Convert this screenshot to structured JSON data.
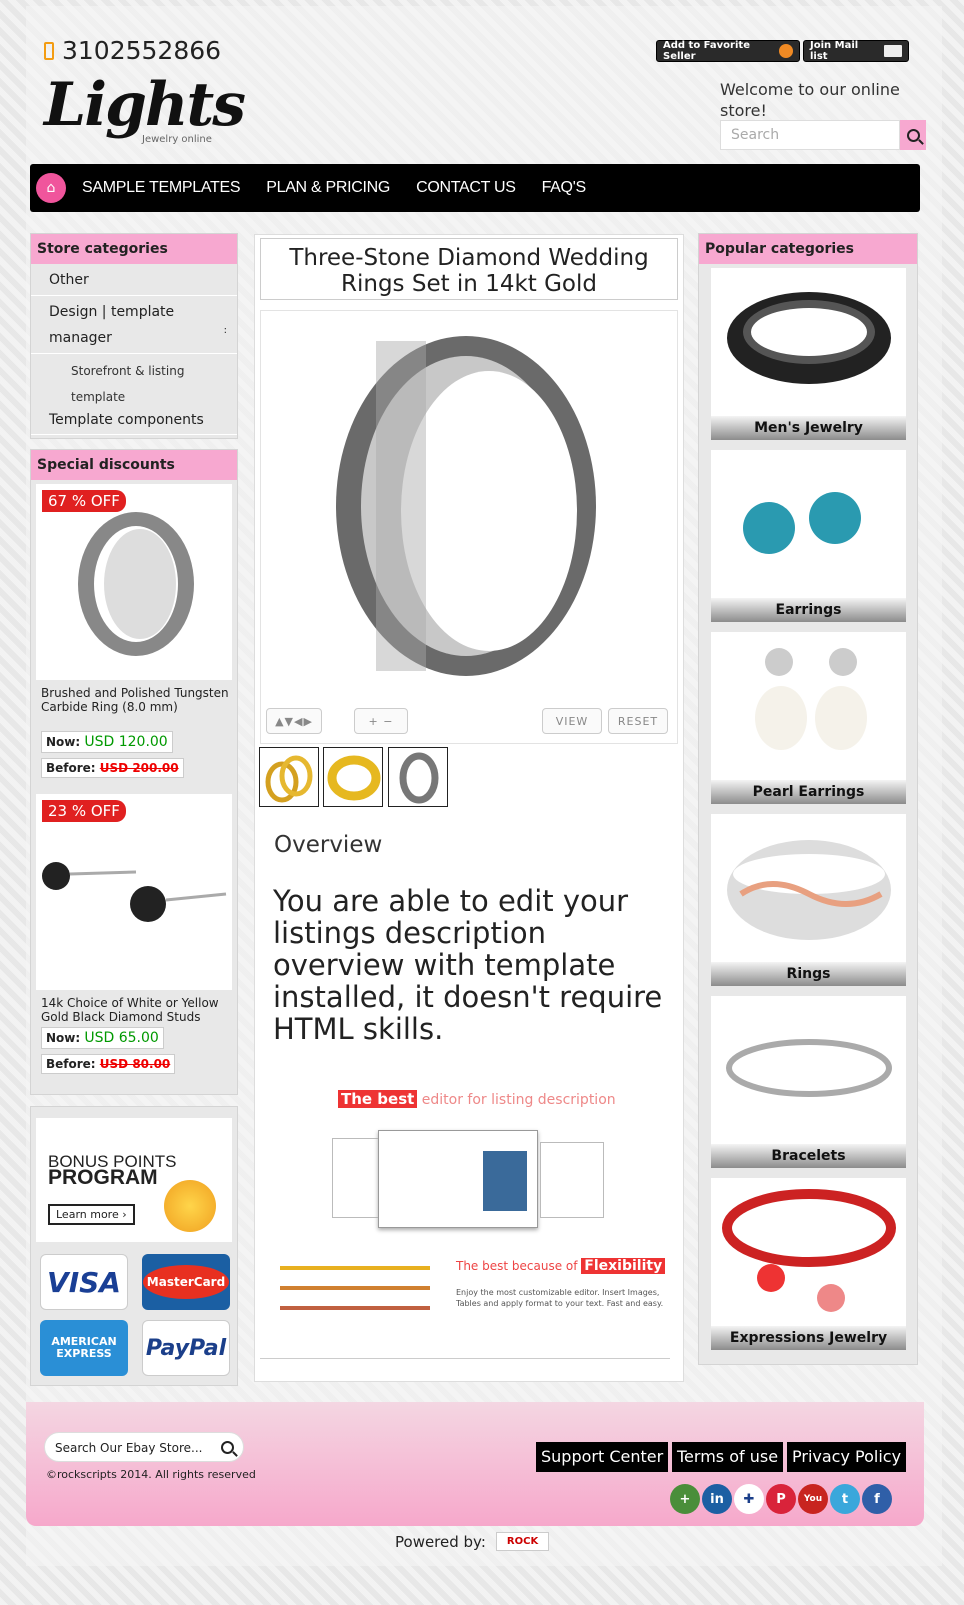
{
  "header": {
    "phone": "3102552866",
    "logo": "Lights",
    "logo_sub": "Jewelry online",
    "fav_seller": "Add to Favorite Seller",
    "mail_list": "Join Mail list",
    "welcome": "Welcome to our online store!",
    "search_placeholder": "Search"
  },
  "nav": [
    "SAMPLE TEMPLATES",
    "PLAN & PRICING",
    "CONTACT US",
    "FAQ'S"
  ],
  "store_categories": {
    "title": "Store categories",
    "other": "Other",
    "design": "Design | template manager",
    "storefront": "Storefront & listing template",
    "components": "Template components"
  },
  "special": {
    "title": "Special discounts",
    "items": [
      {
        "badge": "67 % OFF",
        "name": "Brushed and Polished Tungsten Carbide Ring (8.0 mm)",
        "now_label": "Now:",
        "now": "USD 120.00",
        "before_label": "Before:",
        "before": "USD 200.00"
      },
      {
        "badge": "23 % OFF",
        "name": "14k Choice of White or Yellow Gold Black Diamond Studs",
        "now_label": "Now:",
        "now": "USD 65.00",
        "before_label": "Before:",
        "before": "USD 80.00"
      }
    ]
  },
  "bonus": {
    "line1": "BONUS POINTS",
    "line2": "PROGRAM",
    "cta": "Learn more ›"
  },
  "payments": [
    "VISA",
    "MasterCard",
    "AMERICAN EXPRESS",
    "PayPal"
  ],
  "product": {
    "title": "Three-Stone Diamond Wedding Rings Set in 14kt Gold",
    "view": "VIEW",
    "reset": "RESET",
    "overview_title": "Overview",
    "overview_text": "You are able to edit your listings description overview with template installed, it doesn't require HTML skills.",
    "promo1_hl": "The best",
    "promo1_rest": " editor for listing description",
    "promo2_pre": "The best because of ",
    "promo2_hl": "Flexibility",
    "promo3": "Enjoy the most customizable editor. Insert Images, Tables and apply format to your text. Fast and easy."
  },
  "popular": {
    "title": "Popular categories",
    "items": [
      "Men's Jewelry",
      "Earrings",
      "Pearl Earrings",
      "Rings",
      "Bracelets",
      "Expressions Jewelry"
    ]
  },
  "footer": {
    "search_placeholder": "Search Our Ebay Store...",
    "copyright": "©rockscripts 2014. All rights reserved",
    "links": [
      "Support Center",
      "Terms of use",
      "Privacy Policy"
    ],
    "powered": "Powered by:",
    "powered_brand": "ROCK"
  },
  "colors": {
    "accent": "#f7a8d0",
    "nav_bg": "#000000",
    "badge": "#e02020"
  }
}
